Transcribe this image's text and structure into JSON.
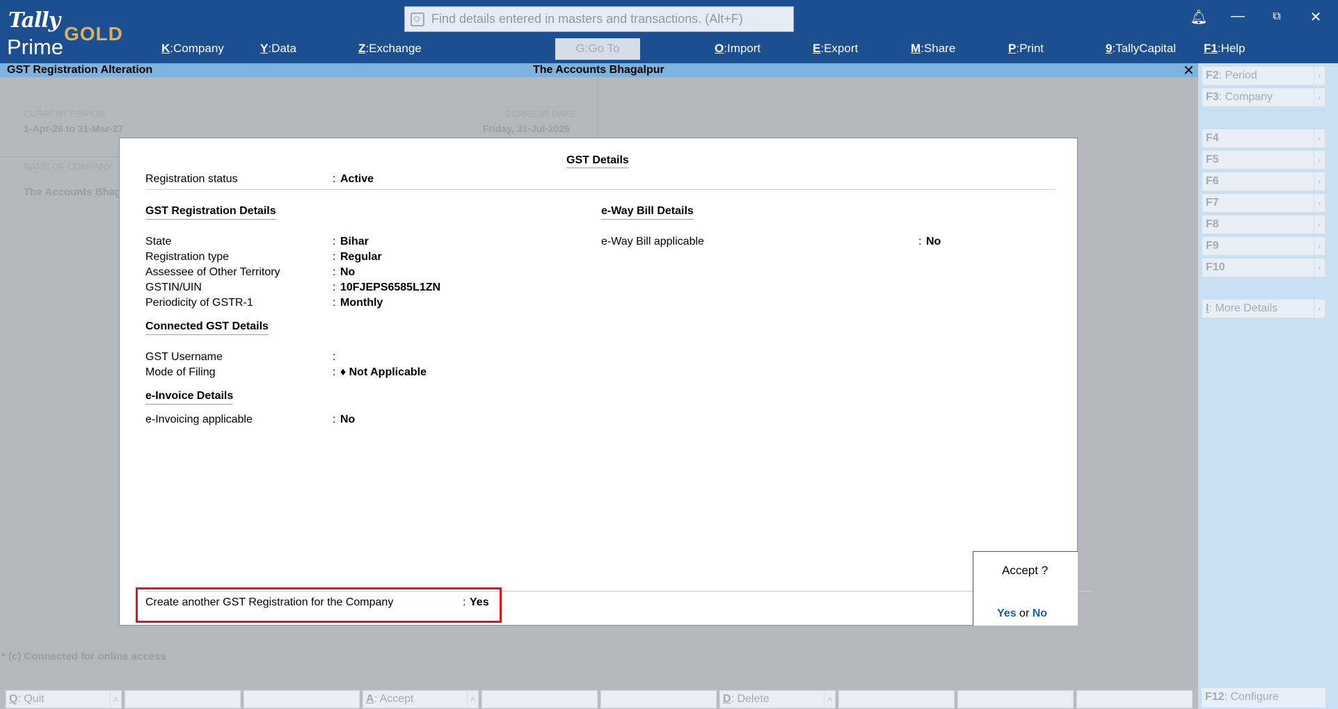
{
  "app": {
    "logo_top": "Tally",
    "logo_bottom": "Prime",
    "edition": "GOLD",
    "search_placeholder": "Find details entered in masters and transactions. (Alt+F)"
  },
  "menu": [
    {
      "key": "K",
      "label": "Company"
    },
    {
      "key": "Y",
      "label": "Data"
    },
    {
      "key": "Z",
      "label": "Exchange"
    },
    {
      "key": "G",
      "label": "Go To"
    },
    {
      "key": "O",
      "label": "Import"
    },
    {
      "key": "E",
      "label": "Export"
    },
    {
      "key": "M",
      "label": "Share"
    },
    {
      "key": "P",
      "label": "Print"
    },
    {
      "key": "9",
      "label": "TallyCapital"
    },
    {
      "key": "F1",
      "label": "Help"
    }
  ],
  "titlebar": {
    "screen": "GST Registration Alteration",
    "company": "The Accounts Bhagalpur"
  },
  "background": {
    "current_period_label": "CURRENT PERIOD",
    "current_period": "1-Apr-26 to 31-Mar-27",
    "current_date_label": "CURRENT DATE",
    "current_date": "Friday, 31-Jul-2026",
    "company_label": "NAME OF COMPANY",
    "company_name": "The Accounts Bhag",
    "online_status": "* (c) Connected for online access"
  },
  "dialog": {
    "title": "GST Details",
    "registration_status_label": "Registration status",
    "registration_status": "Active",
    "gst_reg_header": "GST Registration Details",
    "state_label": "State",
    "state": "Bihar",
    "reg_type_label": "Registration type",
    "reg_type": "Regular",
    "assessee_label": "Assessee of Other Territory",
    "assessee": "No",
    "gstin_label": "GSTIN/UIN",
    "gstin": "10FJEPS6585L1ZN",
    "periodicity_label": "Periodicity of GSTR-1",
    "periodicity": "Monthly",
    "connected_header": "Connected GST Details",
    "username_label": "GST Username",
    "username": "",
    "mode_label": "Mode of Filing",
    "mode": "♦ Not Applicable",
    "einvoice_header": "e-Invoice Details",
    "einvoice_label": "e-Invoicing applicable",
    "einvoice": "No",
    "eway_header": "e-Way Bill Details",
    "eway_label": "e-Way Bill applicable",
    "eway": "No",
    "create_another_label": "Create another GST Registration for the Company",
    "create_another": "Yes"
  },
  "accept": {
    "question": "Accept ?",
    "yes": "Yes",
    "or": "or",
    "no": "No"
  },
  "right_buttons": [
    {
      "key": "F2",
      "label": "Period"
    },
    {
      "key": "F3",
      "label": "Company"
    },
    {
      "key": "F4",
      "label": ""
    },
    {
      "key": "F5",
      "label": ""
    },
    {
      "key": "F6",
      "label": ""
    },
    {
      "key": "F7",
      "label": ""
    },
    {
      "key": "F8",
      "label": ""
    },
    {
      "key": "F9",
      "label": ""
    },
    {
      "key": "F10",
      "label": ""
    },
    {
      "key": "I",
      "label": "More Details"
    },
    {
      "key": "F12",
      "label": "Configure"
    }
  ],
  "bottom_buttons": [
    {
      "key": "Q",
      "label": "Quit"
    },
    {
      "key": "A",
      "label": "Accept"
    },
    {
      "key": "D",
      "label": "Delete"
    }
  ]
}
